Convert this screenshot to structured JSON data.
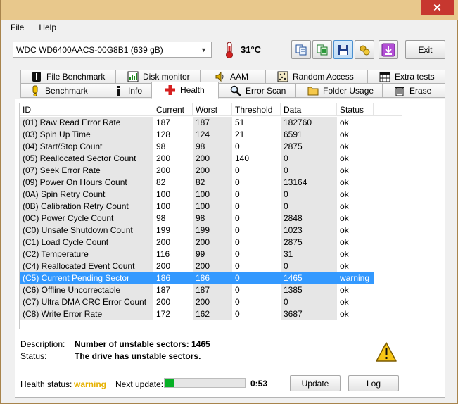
{
  "window": {
    "close_glyph": "✕"
  },
  "menu": {
    "file": "File",
    "help": "Help"
  },
  "toolbar": {
    "drive": "WDC WD6400AACS-00G8B1 (639 gB)",
    "temperature": "31°C",
    "exit_label": "Exit"
  },
  "tabs_top": [
    {
      "label": "File Benchmark",
      "icon": "info-icon"
    },
    {
      "label": "Disk monitor",
      "icon": "bar-chart-icon"
    },
    {
      "label": "AAM",
      "icon": "speaker-icon"
    },
    {
      "label": "Random Access",
      "icon": "dots-grid-icon"
    },
    {
      "label": "Extra tests",
      "icon": "calendar-icon"
    }
  ],
  "tabs_bottom": [
    {
      "label": "Benchmark",
      "icon": "exclamation-icon"
    },
    {
      "label": "Info",
      "icon": "info-icon"
    },
    {
      "label": "Health",
      "icon": "red-cross-icon",
      "active": true
    },
    {
      "label": "Error Scan",
      "icon": "magnifier-icon"
    },
    {
      "label": "Folder Usage",
      "icon": "folder-icon"
    },
    {
      "label": "Erase",
      "icon": "trash-icon"
    }
  ],
  "table": {
    "headers": [
      "ID",
      "Current",
      "Worst",
      "Threshold",
      "Data",
      "Status"
    ],
    "rows": [
      [
        "(01) Raw Read Error Rate",
        "187",
        "187",
        "51",
        "182760",
        "ok"
      ],
      [
        "(03) Spin Up Time",
        "128",
        "124",
        "21",
        "6591",
        "ok"
      ],
      [
        "(04) Start/Stop Count",
        "98",
        "98",
        "0",
        "2875",
        "ok"
      ],
      [
        "(05) Reallocated Sector Count",
        "200",
        "200",
        "140",
        "0",
        "ok"
      ],
      [
        "(07) Seek Error Rate",
        "200",
        "200",
        "0",
        "0",
        "ok"
      ],
      [
        "(09) Power On Hours Count",
        "82",
        "82",
        "0",
        "13164",
        "ok"
      ],
      [
        "(0A) Spin Retry Count",
        "100",
        "100",
        "0",
        "0",
        "ok"
      ],
      [
        "(0B) Calibration Retry Count",
        "100",
        "100",
        "0",
        "0",
        "ok"
      ],
      [
        "(0C) Power Cycle Count",
        "98",
        "98",
        "0",
        "2848",
        "ok"
      ],
      [
        "(C0) Unsafe Shutdown Count",
        "199",
        "199",
        "0",
        "1023",
        "ok"
      ],
      [
        "(C1) Load Cycle Count",
        "200",
        "200",
        "0",
        "2875",
        "ok"
      ],
      [
        "(C2) Temperature",
        "116",
        "99",
        "0",
        "31",
        "ok"
      ],
      [
        "(C4) Reallocated Event Count",
        "200",
        "200",
        "0",
        "0",
        "ok"
      ],
      [
        "(C5) Current Pending Sector",
        "186",
        "186",
        "0",
        "1465",
        "warning"
      ],
      [
        "(C6) Offline Uncorrectable",
        "187",
        "187",
        "0",
        "1385",
        "ok"
      ],
      [
        "(C7) Ultra DMA CRC Error Count",
        "200",
        "200",
        "0",
        "0",
        "ok"
      ],
      [
        "(C8) Write Error Rate",
        "172",
        "162",
        "0",
        "3687",
        "ok"
      ]
    ],
    "selected_row": 13
  },
  "details": {
    "description_label": "Description:",
    "description_value": "Number of unstable sectors: 1465",
    "status_label": "Status:",
    "status_value": "The drive has unstable sectors."
  },
  "footer": {
    "health_label": "Health status:",
    "health_value": "warning",
    "next_update_label": "Next update:",
    "progress_fraction": 0.12,
    "countdown": "0:53",
    "update_button": "Update",
    "log_button": "Log"
  },
  "colors": {
    "accent_selection": "#3399ff",
    "warning_text": "#e6b100",
    "progress_fill": "#06b025"
  }
}
